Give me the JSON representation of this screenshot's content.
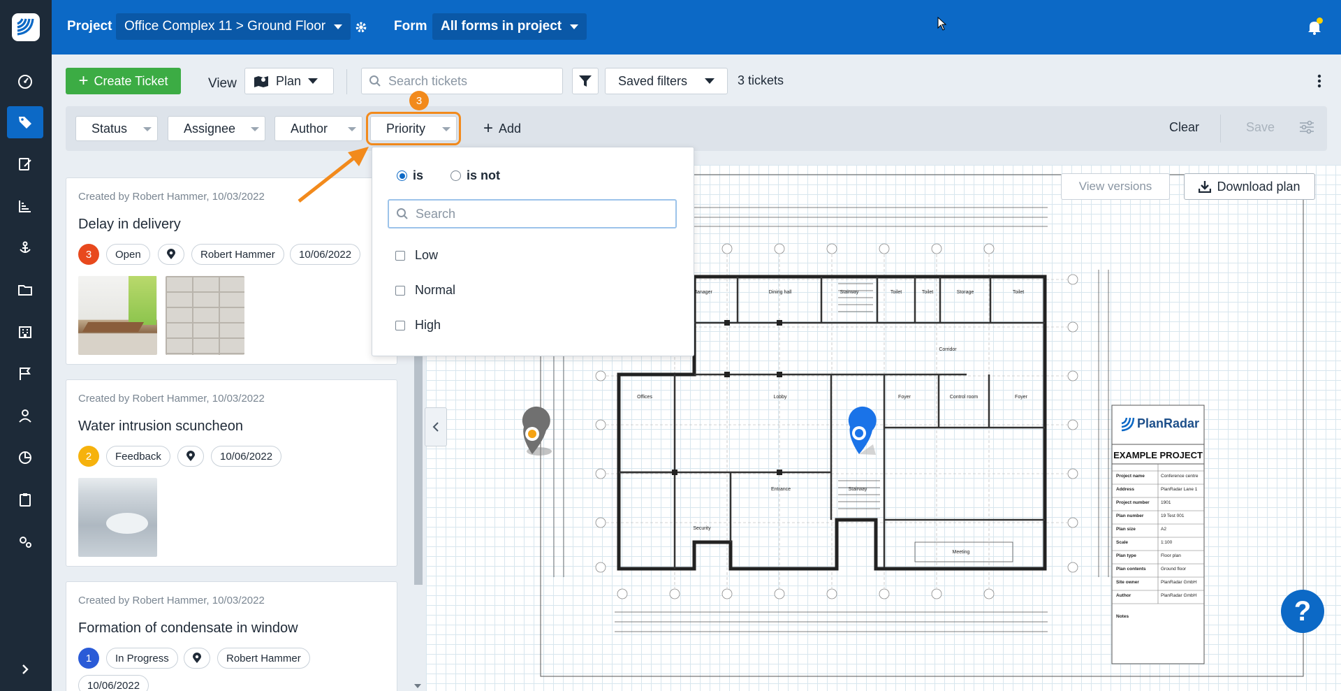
{
  "topbar": {
    "project_label": "Project",
    "project_value": "Office Complex 11 > Ground Floor",
    "form_label": "Form",
    "form_value": "All forms in project"
  },
  "toolbar": {
    "create_ticket": "Create Ticket",
    "view_label": "View",
    "view_value": "Plan",
    "search_placeholder": "Search tickets",
    "saved_filters": "Saved filters",
    "ticket_count": "3 tickets"
  },
  "filters": {
    "status": "Status",
    "assignee": "Assignee",
    "author": "Author",
    "priority": "Priority",
    "priority_count": "3",
    "add": "Add",
    "clear": "Clear",
    "save": "Save"
  },
  "dropdown": {
    "is": "is",
    "is_not": "is not",
    "search_placeholder": "Search",
    "options": [
      "Low",
      "Normal",
      "High"
    ]
  },
  "tickets": [
    {
      "meta": "Created by Robert Hammer, 10/03/2022",
      "title": "Delay in delivery",
      "priority": "3",
      "priority_color": "#e8491d",
      "status": "Open",
      "assignee": "Robert Hammer",
      "due": "10/06/2022"
    },
    {
      "meta": "Created by Robert Hammer, 10/03/2022",
      "title": "Water intrusion scuncheon",
      "priority": "2",
      "priority_color": "#f6b20d",
      "status": "Feedback",
      "due": "10/06/2022"
    },
    {
      "meta": "Created by Robert Hammer, 10/03/2022",
      "title": "Formation of condensate in window",
      "priority": "1",
      "priority_color": "#2a5bd7",
      "status": "In Progress",
      "assignee": "Robert Hammer",
      "due": "10/06/2022"
    }
  ],
  "plan": {
    "view_versions": "View versions",
    "download_plan": "Download plan",
    "brand": "PlanRadar",
    "project_title": "EXAMPLE PROJECT",
    "rows": [
      [
        "Project name",
        "Conference centre"
      ],
      [
        "Address",
        "PlanRadar Lane 1"
      ],
      [
        "Project number",
        "1901"
      ],
      [
        "Plan number",
        "19 Test 001"
      ],
      [
        "Plan size",
        "A2"
      ],
      [
        "Scale",
        "1:100"
      ],
      [
        "Plan type",
        "Floor plan"
      ],
      [
        "Plan contents",
        "Ground floor"
      ],
      [
        "Site owner",
        "PlanRadar GmbH"
      ],
      [
        "Author",
        "PlanRadar GmbH"
      ],
      [
        "Notes",
        ""
      ]
    ],
    "rooms": [
      "Manager",
      "Dining hall",
      "Stairway",
      "Toilet",
      "Toilet",
      "Storage",
      "Toilet",
      "Corridor",
      "Offices",
      "Lobby",
      "Foyer",
      "Control room",
      "Foyer",
      "Stairway",
      "Entrance",
      "Security",
      "Meeting"
    ]
  },
  "help": "?",
  "colors": {
    "brand": "#0c69c6",
    "accent": "#f28a1c",
    "create": "#3cac44",
    "rail": "#1d2a38"
  }
}
